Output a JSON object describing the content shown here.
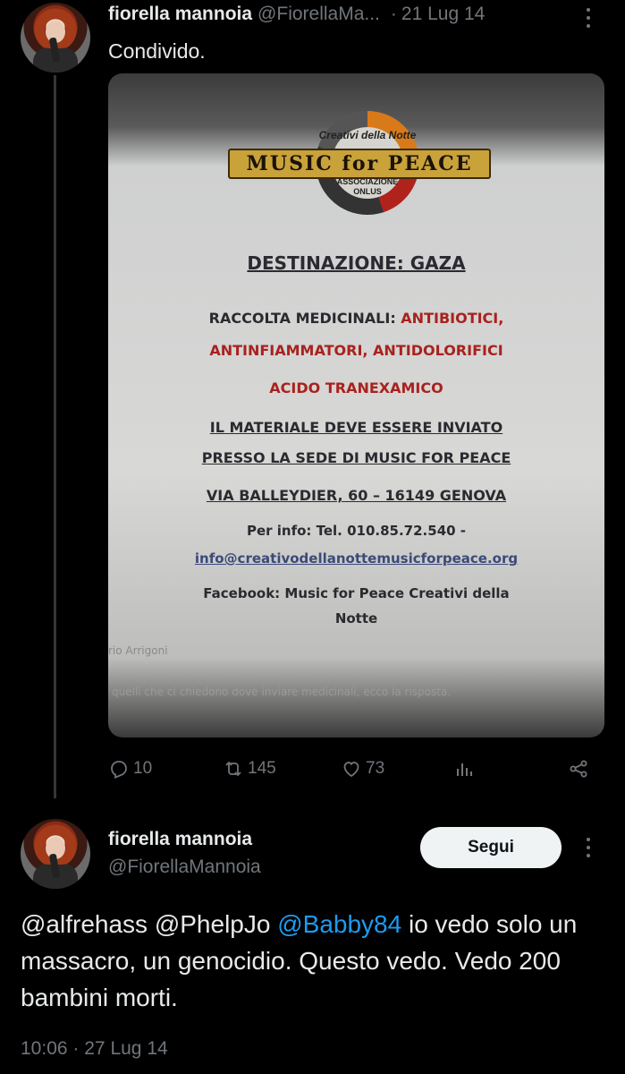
{
  "tweet1": {
    "name": "fiorella mannoia",
    "handle": "@FiorellaMa...",
    "separator": "·",
    "date": "21 Lug 14",
    "text": "Condivido.",
    "flyer": {
      "logo_top": "Creativi della Notte",
      "logo_main": "MUSIC for PEACE",
      "logo_sub_1": "ASSOCIAZIONE",
      "logo_sub_2": "ONLUS",
      "destination": "DESTINAZIONE: GAZA",
      "collection_label": "RACCOLTA MEDICINALI:",
      "collection_item_1": "ANTIBIOTICI,",
      "collection_item_2": "ANTINFIAMMATORI, ANTIDOLORIFICI",
      "collection_item_3": "ACIDO TRANEXAMICO",
      "send_line_1": "IL MATERIALE DEVE ESSERE INVIATO",
      "send_line_2": "PRESSO LA SEDE DI MUSIC FOR PEACE",
      "address": "VIA BALLEYDIER, 60 – 16149 GENOVA",
      "info_phone": "Per info: Tel. 010.85.72.540 -",
      "info_email": "info@creativodellanottemusicforpeace.org",
      "facebook_line_1": "Facebook: Music for Peace Creativi della",
      "facebook_line_2": "Notte",
      "author_fragment": "rio Arrigoni",
      "caption_fragment": "quelli che ci chiedono dove inviare medicinali, ecco la risposta."
    },
    "actions": {
      "replies": "10",
      "reposts": "145",
      "likes": "73"
    }
  },
  "tweet2": {
    "name": "fiorella mannoia",
    "handle": "@FiorellaMannoia",
    "follow_label": "Segui",
    "mention_1": "@alfrehass",
    "mention_2": "@PhelpJo",
    "mention_3": "@Babby84",
    "text_part_1": " io vedo solo un massacro, un genocidio. Questo vedo. Vedo 200 bambini morti.",
    "time": "10:06",
    "separator": "·",
    "date": "27 Lug 14"
  },
  "colors": {
    "background": "#000000",
    "text": "#e7e9ea",
    "muted": "#71767b",
    "link": "#1d9bf0",
    "follow_button": "#eff3f4"
  },
  "icons": [
    "more-icon",
    "reply-icon",
    "repost-icon",
    "like-icon",
    "views-icon",
    "share-icon"
  ]
}
